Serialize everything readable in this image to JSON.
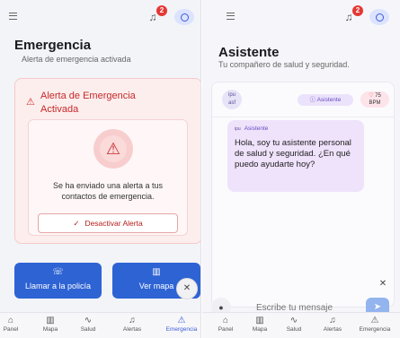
{
  "left": {
    "title": "Emergencia",
    "subtitle": "Alerta de emergencia activada",
    "notifications": "2",
    "alert_title": "Alerta de Emergencia Activada",
    "alert_message": "Se ha enviado una alerta a tus contactos de emergencia.",
    "deactivate_label": "Desactivar Alerta",
    "call_police_label": "Llamar a la policía",
    "view_map_label": "Ver mapa"
  },
  "right": {
    "title": "Asistente",
    "subtitle": "Tu compañero de salud y seguridad.",
    "notifications": "2",
    "assistant_pill": "Asistente",
    "bpm_value": "75",
    "bpm_unit": "BPM",
    "bubble_sender": "Asistente",
    "bubble_message": "Hola, soy tu asistente personal de salud y seguridad. ¿En qué puedo ayudarte hoy?",
    "input_placeholder": "Escribe tu mensaje"
  },
  "nav": [
    {
      "label": "Panel",
      "icon": "home-icon"
    },
    {
      "label": "Mapa",
      "icon": "map-icon"
    },
    {
      "label": "Salud",
      "icon": "pulse-icon"
    },
    {
      "label": "Alertas",
      "icon": "bell-icon"
    },
    {
      "label": "Emergencia",
      "icon": "warning-icon"
    }
  ],
  "colors": {
    "accent": "#3f5bd6",
    "alert_red": "#c62828",
    "button_blue": "#2e63d4",
    "assistant_purple": "#6a4bc4"
  }
}
